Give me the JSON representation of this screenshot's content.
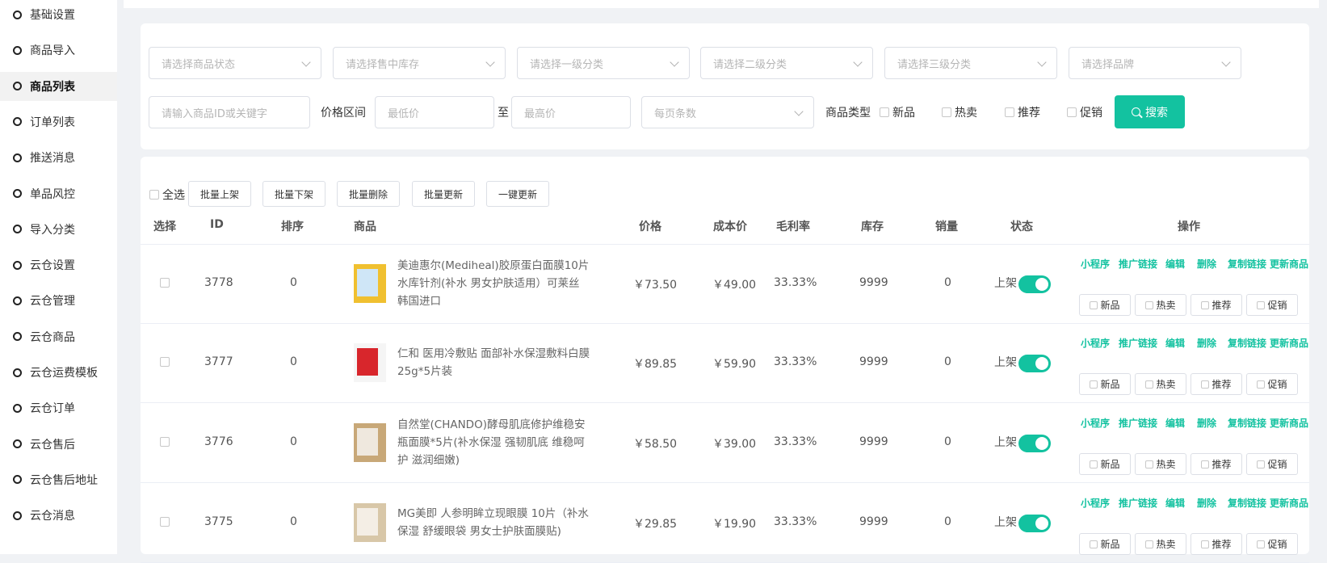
{
  "sidebar": {
    "items": [
      {
        "label": "基础设置",
        "active": false
      },
      {
        "label": "商品导入",
        "active": false
      },
      {
        "label": "商品列表",
        "active": true
      },
      {
        "label": "订单列表",
        "active": false
      },
      {
        "label": "推送消息",
        "active": false
      },
      {
        "label": "单品风控",
        "active": false
      },
      {
        "label": "导入分类",
        "active": false
      },
      {
        "label": "云仓设置",
        "active": false
      },
      {
        "label": "云仓管理",
        "active": false
      },
      {
        "label": "云仓商品",
        "active": false
      },
      {
        "label": "云仓运费模板",
        "active": false
      },
      {
        "label": "云仓订单",
        "active": false
      },
      {
        "label": "云仓售后",
        "active": false
      },
      {
        "label": "云仓售后地址",
        "active": false
      },
      {
        "label": "云仓消息",
        "active": false
      }
    ]
  },
  "filters": {
    "status_placeholder": "请选择商品状态",
    "stock_placeholder": "请选择售中库存",
    "cat1_placeholder": "请选择一级分类",
    "cat2_placeholder": "请选择二级分类",
    "cat3_placeholder": "请选择三级分类",
    "brand_placeholder": "请选择品牌",
    "keyword_placeholder": "请输入商品ID或关键字",
    "price_label": "价格区间",
    "min_placeholder": "最低价",
    "to_label": "至",
    "max_placeholder": "最高价",
    "page_size_placeholder": "每页条数",
    "type_label": "商品类型",
    "type_options": [
      "新品",
      "热卖",
      "推荐",
      "促销"
    ],
    "search_label": "搜索"
  },
  "toolbar": {
    "select_all": "全选",
    "batch_on": "批量上架",
    "batch_off": "批量下架",
    "batch_delete": "批量删除",
    "batch_update": "批量更新",
    "one_click_update": "一键更新"
  },
  "table": {
    "headers": [
      "选择",
      "ID",
      "排序",
      "商品",
      "价格",
      "成本价",
      "毛利率",
      "库存",
      "销量",
      "状态",
      "操作"
    ],
    "rows": [
      {
        "id": "3778",
        "sort": "0",
        "name_lines": [
          "美迪惠尔(Mediheal)胶原蛋白面膜10片",
          "水库针剂(补水 男女护肤适用）可莱丝",
          "韩国进口"
        ],
        "price": "￥73.50",
        "cost": "￥49.00",
        "margin": "33.33%",
        "stock": "9999",
        "sales": "0",
        "status": "上架",
        "on": true
      },
      {
        "id": "3777",
        "sort": "0",
        "name_lines": [
          "仁和 医用冷敷贴 面部补水保湿敷料白膜",
          "25g*5片装"
        ],
        "price": "￥89.85",
        "cost": "￥59.90",
        "margin": "33.33%",
        "stock": "9999",
        "sales": "0",
        "status": "上架",
        "on": true
      },
      {
        "id": "3776",
        "sort": "0",
        "name_lines": [
          "自然堂(CHANDO)酵母肌底修护维稳安",
          "瓶面膜*5片(补水保湿 强韧肌底 维稳呵",
          "护 滋润细嫩)"
        ],
        "price": "￥58.50",
        "cost": "￥39.00",
        "margin": "33.33%",
        "stock": "9999",
        "sales": "0",
        "status": "上架",
        "on": true
      },
      {
        "id": "3775",
        "sort": "0",
        "name_lines": [
          "MG美即 人参明眸立现眼膜 10片（补水",
          "保湿 舒缓眼袋 男女士护肤面膜贴)"
        ],
        "price": "￥29.85",
        "cost": "￥19.90",
        "margin": "33.33%",
        "stock": "9999",
        "sales": "0",
        "status": "上架",
        "on": true
      }
    ],
    "actions": [
      "小程序",
      "推广链接",
      "编辑",
      "删除",
      "复制链接",
      "更新商品"
    ],
    "tags": [
      "新品",
      "热卖",
      "推荐",
      "促销"
    ]
  },
  "colors": {
    "accent": "#13c2a0"
  }
}
